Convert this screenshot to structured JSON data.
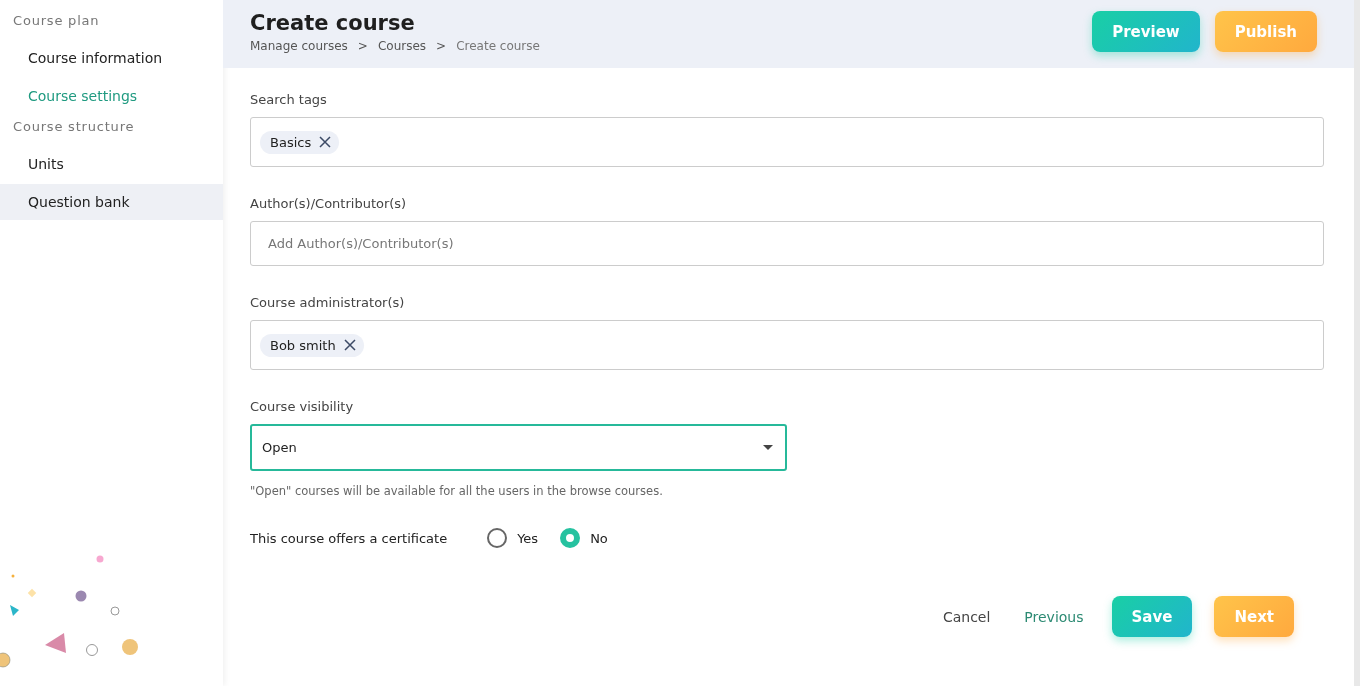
{
  "sidebar": {
    "sections": [
      {
        "title": "Course plan",
        "items": [
          {
            "label": "Course information",
            "selected": false,
            "highlighted": false
          },
          {
            "label": "Course settings",
            "selected": true,
            "highlighted": false
          }
        ]
      },
      {
        "title": "Course structure",
        "items": [
          {
            "label": "Units",
            "selected": false,
            "highlighted": false
          },
          {
            "label": "Question bank",
            "selected": false,
            "highlighted": true
          }
        ]
      }
    ]
  },
  "header": {
    "title": "Create course",
    "breadcrumbs": [
      "Manage courses",
      "Courses",
      "Create course"
    ],
    "separator": ">",
    "buttons": [
      {
        "label": "Preview",
        "kind": "teal"
      },
      {
        "label": "Publish",
        "kind": "orange"
      }
    ]
  },
  "fields": [
    {
      "kind": "tags",
      "label": "Search tags",
      "tags": [
        {
          "text": "Basics"
        }
      ]
    },
    {
      "kind": "text",
      "label": "Author(s)/Contributor(s)",
      "placeholder": "Add Author(s)/Contributor(s)"
    },
    {
      "kind": "tags",
      "label": "Course administrator(s)",
      "tags": [
        {
          "text": "Bob smith"
        }
      ]
    },
    {
      "kind": "select",
      "label": "Course visibility",
      "value": "Open",
      "focused": true,
      "hint": "\"Open\" courses will be available for all the users in the browse courses."
    }
  ],
  "certificate": {
    "label": "This course offers a certificate",
    "options": [
      {
        "label": "Yes",
        "selected": false
      },
      {
        "label": "No",
        "selected": true
      }
    ]
  },
  "footer": {
    "buttons": [
      {
        "label": "Cancel",
        "kind": "plain"
      },
      {
        "label": "Previous",
        "kind": "link"
      },
      {
        "label": "Save",
        "kind": "teal"
      },
      {
        "label": "Next",
        "kind": "orange"
      }
    ]
  }
}
